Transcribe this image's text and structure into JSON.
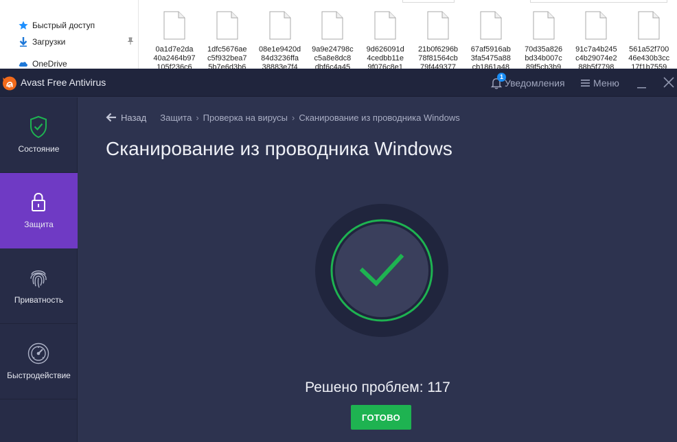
{
  "explorer": {
    "nav": [
      {
        "label": "Быстрый доступ",
        "icon": "star-icon"
      },
      {
        "label": "Загрузки",
        "icon": "download-arrow-icon",
        "pinned": true
      },
      {
        "label": "OneDrive",
        "icon": "cloud-icon"
      }
    ],
    "files": [
      {
        "line1": "0a1d7e2da",
        "line2": "40a2464b97",
        "line3": "105f236c6"
      },
      {
        "line1": "1dfc5676ae",
        "line2": "c5f932bea7",
        "line3": "5b7e6d3b6"
      },
      {
        "line1": "08e1e9420d",
        "line2": "84d3236ffa",
        "line3": "38883e7f4"
      },
      {
        "line1": "9a9e24798c",
        "line2": "c5a8e8dc8",
        "line3": "dbf6c4a45"
      },
      {
        "line1": "9d626091d",
        "line2": "4cedbb11e",
        "line3": "9f076c8e1"
      },
      {
        "line1": "21b0f6296b",
        "line2": "78f81564cb",
        "line3": "79f449377"
      },
      {
        "line1": "67af5916ab",
        "line2": "3fa5475a88",
        "line3": "cb1861a48"
      },
      {
        "line1": "70d35a826",
        "line2": "bd34b007c",
        "line3": "89f5cb3b9"
      },
      {
        "line1": "91c7a4b245",
        "line2": "c4b29074e2",
        "line3": "88b5f7798"
      },
      {
        "line1": "561a52f700",
        "line2": "46e430b3cc",
        "line3": "17f1b7559"
      }
    ]
  },
  "app": {
    "title": "Avast Free Antivirus",
    "notifications": {
      "label": "Уведомления",
      "count": "1"
    },
    "menu_label": "Меню"
  },
  "sidebar": {
    "items": [
      {
        "label": "Состояние",
        "icon": "shield-check-icon",
        "active": false
      },
      {
        "label": "Защита",
        "icon": "lock-icon",
        "active": true
      },
      {
        "label": "Приватность",
        "icon": "fingerprint-icon",
        "active": false
      },
      {
        "label": "Быстродействие",
        "icon": "speedometer-icon",
        "active": false
      }
    ]
  },
  "breadcrumb": {
    "back_label": "Назад",
    "items": [
      "Защита",
      "Проверка на вирусы",
      "Сканирование из проводника Windows"
    ]
  },
  "page": {
    "title": "Сканирование из проводника Windows",
    "result": "Решено проблем: 117",
    "done_label": "ГОТОВО"
  },
  "colors": {
    "accent_purple": "#6f3ac4",
    "success_green": "#1eb351",
    "background": "#2d334f",
    "sidebar": "#272c47",
    "titlebar": "#20253d",
    "avast_orange": "#f26a1b"
  }
}
